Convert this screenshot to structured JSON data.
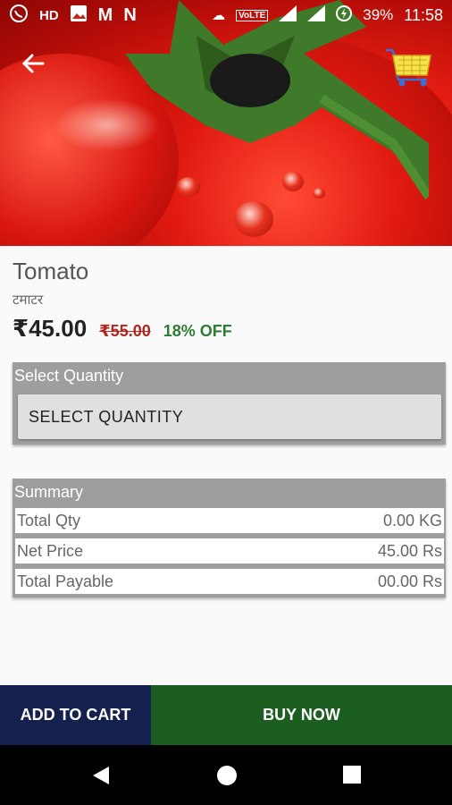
{
  "status_bar": {
    "battery": "39%",
    "time": "11:58",
    "network": "VoLTE",
    "lte": "LTE",
    "icons": [
      "whatsapp-icon",
      "hd-icon",
      "gallery-icon",
      "myntra-icon",
      "news-icon",
      "weather-icon",
      "volte-icon",
      "signal-icon",
      "signal-icon",
      "battery-charging-icon"
    ]
  },
  "header": {
    "back_icon": "arrow-left-icon",
    "cart_icon": "shopping-cart-icon"
  },
  "product": {
    "name": "Tomato",
    "name_hindi": "टमाटर",
    "price": "₹45.00",
    "old_price": "₹55.00",
    "discount": "18% OFF"
  },
  "quantity": {
    "title": "Select Quantity",
    "button_label": "SELECT QUANTITY"
  },
  "summary": {
    "title": "Summary",
    "rows": [
      {
        "label": "Total Qty",
        "value": "0.00 KG"
      },
      {
        "label": "Net Price",
        "value": "45.00 Rs"
      },
      {
        "label": "Total Payable",
        "value": "00.00 Rs"
      }
    ]
  },
  "actions": {
    "add_to_cart": "ADD TO CART",
    "buy_now": "BUY NOW"
  },
  "colors": {
    "add_to_cart_bg": "#14204e",
    "buy_now_bg": "#1b5e20",
    "discount": "#2e7d32",
    "old_price": "#b3261e"
  }
}
